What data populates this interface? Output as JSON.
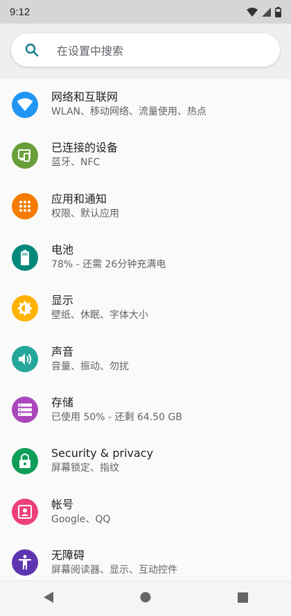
{
  "status_bar": {
    "time": "9:12"
  },
  "search": {
    "placeholder": "在设置中搜索"
  },
  "colors": {
    "network": "#2196f3",
    "connected": "#689f38",
    "apps": "#f57c00",
    "battery": "#00897b",
    "display": "#ffb300",
    "sound": "#26a69a",
    "storage": "#ab47bc",
    "security": "#0f9d58",
    "accounts": "#ec407a",
    "accessibility": "#5e35b1"
  },
  "settings": [
    {
      "title": "网络和互联网",
      "subtitle": "WLAN、移动网络、流量使用、热点",
      "icon": "wifi-icon"
    },
    {
      "title": "已连接的设备",
      "subtitle": "蓝牙、NFC",
      "icon": "devices-icon"
    },
    {
      "title": "应用和通知",
      "subtitle": "权限、默认应用",
      "icon": "apps-grid-icon"
    },
    {
      "title": "电池",
      "subtitle": "78% - 还需 26分钟充满电",
      "icon": "battery-icon"
    },
    {
      "title": "显示",
      "subtitle": "壁纸、休眠、字体大小",
      "icon": "brightness-icon"
    },
    {
      "title": "声音",
      "subtitle": "音量、振动、勿扰",
      "icon": "volume-icon"
    },
    {
      "title": "存储",
      "subtitle": "已使用 50% - 还剩 64.50 GB",
      "icon": "storage-icon"
    },
    {
      "title": "Security & privacy",
      "subtitle": "屏幕锁定、指纹",
      "icon": "lock-icon"
    },
    {
      "title": "帐号",
      "subtitle": "Google、QQ",
      "icon": "account-icon"
    },
    {
      "title": "无障碍",
      "subtitle": "屏幕阅读器、显示、互动控件",
      "icon": "accessibility-icon"
    }
  ],
  "nav": {
    "back": "back-icon",
    "home": "home-icon",
    "recents": "recents-icon"
  }
}
